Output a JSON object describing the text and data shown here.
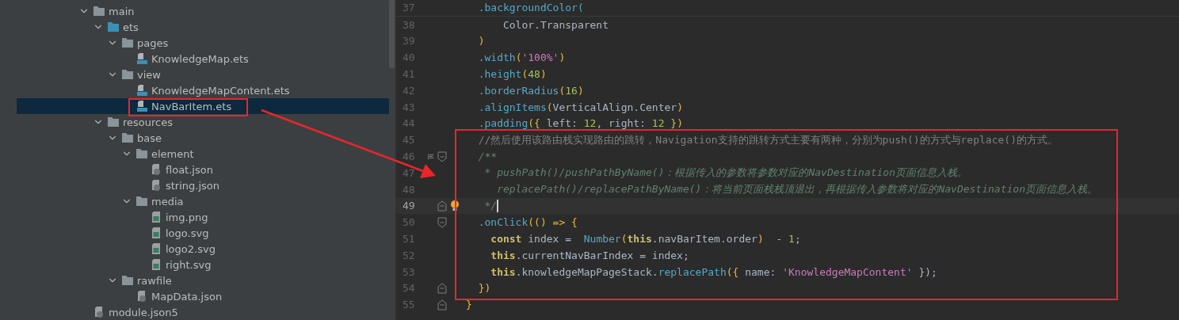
{
  "project_tree": {
    "items": [
      {
        "label": "main",
        "kind": "folder",
        "expanded": true,
        "selected": false,
        "children": [
          {
            "label": "ets",
            "kind": "source-folder",
            "expanded": true,
            "selected": false,
            "children": [
              {
                "label": "pages",
                "kind": "folder",
                "expanded": true,
                "selected": false,
                "children": [
                  {
                    "label": "KnowledgeMap.ets",
                    "kind": "ets",
                    "selected": false
                  }
                ]
              },
              {
                "label": "view",
                "kind": "folder",
                "expanded": true,
                "selected": false,
                "children": [
                  {
                    "label": "KnowledgeMapContent.ets",
                    "kind": "ets",
                    "selected": false
                  },
                  {
                    "label": "NavBarItem.ets",
                    "kind": "ets",
                    "selected": true
                  }
                ]
              }
            ]
          },
          {
            "label": "resources",
            "kind": "folder",
            "expanded": true,
            "selected": false,
            "children": [
              {
                "label": "base",
                "kind": "folder",
                "expanded": true,
                "selected": false,
                "children": [
                  {
                    "label": "element",
                    "kind": "folder",
                    "expanded": true,
                    "selected": false,
                    "children": [
                      {
                        "label": "float.json",
                        "kind": "json",
                        "selected": false
                      },
                      {
                        "label": "string.json",
                        "kind": "json",
                        "selected": false
                      }
                    ]
                  },
                  {
                    "label": "media",
                    "kind": "folder",
                    "expanded": true,
                    "selected": false,
                    "children": [
                      {
                        "label": "img.png",
                        "kind": "image",
                        "selected": false
                      },
                      {
                        "label": "logo.svg",
                        "kind": "image",
                        "selected": false
                      },
                      {
                        "label": "logo2.svg",
                        "kind": "image",
                        "selected": false
                      },
                      {
                        "label": "right.svg",
                        "kind": "image",
                        "selected": false
                      }
                    ]
                  }
                ]
              },
              {
                "label": "rawfile",
                "kind": "folder",
                "expanded": true,
                "selected": false,
                "children": [
                  {
                    "label": "MapData.json",
                    "kind": "json",
                    "selected": false
                  }
                ]
              }
            ]
          }
        ]
      },
      {
        "label": "module.json5",
        "kind": "json",
        "selected": false,
        "outdent": true
      }
    ]
  },
  "editor": {
    "lines": [
      {
        "number": "37",
        "current": false,
        "tokens": [
          {
            "text": "  .backgroundColor(",
            "kind": "method"
          }
        ]
      },
      {
        "number": "38",
        "current": false,
        "tokens": [
          {
            "text": "      Color.Transparent",
            "kind": "plain"
          }
        ]
      },
      {
        "number": "39",
        "current": false,
        "tokens": [
          {
            "text": "  )",
            "kind": "paren"
          }
        ]
      },
      {
        "number": "40",
        "current": false,
        "tokens": [
          {
            "text": "  .width",
            "kind": "method"
          },
          {
            "text": "(",
            "kind": "paren"
          },
          {
            "text": "'100%'",
            "kind": "string"
          },
          {
            "text": ")",
            "kind": "paren"
          }
        ]
      },
      {
        "number": "41",
        "current": false,
        "tokens": [
          {
            "text": "  .height",
            "kind": "method"
          },
          {
            "text": "(",
            "kind": "paren"
          },
          {
            "text": "48",
            "kind": "number"
          },
          {
            "text": ")",
            "kind": "paren"
          }
        ]
      },
      {
        "number": "42",
        "current": false,
        "tokens": [
          {
            "text": "  .borderRadius",
            "kind": "method"
          },
          {
            "text": "(",
            "kind": "paren"
          },
          {
            "text": "16",
            "kind": "number"
          },
          {
            "text": ")",
            "kind": "paren"
          }
        ]
      },
      {
        "number": "43",
        "current": false,
        "tokens": [
          {
            "text": "  .alignItems",
            "kind": "method"
          },
          {
            "text": "(",
            "kind": "paren"
          },
          {
            "text": "VerticalAlign.Center",
            "kind": "plain"
          },
          {
            "text": ")",
            "kind": "paren"
          }
        ]
      },
      {
        "number": "44",
        "current": false,
        "tokens": [
          {
            "text": "  .padding",
            "kind": "method"
          },
          {
            "text": "({",
            "kind": "paren"
          },
          {
            "text": " left: ",
            "kind": "plain"
          },
          {
            "text": "12",
            "kind": "number"
          },
          {
            "text": ", right: ",
            "kind": "plain"
          },
          {
            "text": "12",
            "kind": "number"
          },
          {
            "text": " })",
            "kind": "paren"
          }
        ]
      },
      {
        "number": "45",
        "current": false,
        "tokens": [
          {
            "text": "  //然后使用该路由栈实现路由的跳转，Navigation支持的跳转方式主要有两种，分别为push()的方式与replace()的方式。",
            "kind": "comment"
          }
        ]
      },
      {
        "number": "46",
        "current": false,
        "fold_start": true,
        "gutter_icon": true,
        "tokens": [
          {
            "text": "  /**",
            "kind": "doc"
          }
        ]
      },
      {
        "number": "47",
        "current": false,
        "tokens": [
          {
            "text": "   * pushPath()/pushPathByName()：根据传入的参数将参数对应的NavDestination页面信息入栈。",
            "kind": "doc"
          }
        ]
      },
      {
        "number": "48",
        "current": false,
        "tokens": [
          {
            "text": "     replacePath()/replacePathByName()：将当前页面栈栈顶退出，再根据传入参数将对应的NavDestination页面信息入栈。",
            "kind": "doc"
          }
        ]
      },
      {
        "number": "49",
        "current": true,
        "fold_end": true,
        "bulb": true,
        "tokens": [
          {
            "text": "   */",
            "kind": "doc"
          }
        ]
      },
      {
        "number": "50",
        "current": false,
        "fold_start": true,
        "tokens": [
          {
            "text": "  .onClick",
            "kind": "method"
          },
          {
            "text": "(() => {",
            "kind": "paren"
          }
        ]
      },
      {
        "number": "51",
        "current": false,
        "tokens": [
          {
            "text": "    const ",
            "kind": "keyword"
          },
          {
            "text": "index =  ",
            "kind": "plain"
          },
          {
            "text": "Number",
            "kind": "method"
          },
          {
            "text": "(",
            "kind": "paren"
          },
          {
            "text": "this",
            "kind": "keyword"
          },
          {
            "text": ".navBarItem.order",
            "kind": "plain"
          },
          {
            "text": ")",
            "kind": "paren"
          },
          {
            "text": "  - ",
            "kind": "plain"
          },
          {
            "text": "1",
            "kind": "number"
          },
          {
            "text": ";",
            "kind": "plain"
          }
        ]
      },
      {
        "number": "52",
        "current": false,
        "tokens": [
          {
            "text": "    this",
            "kind": "keyword"
          },
          {
            "text": ".currentNavBarIndex = index;",
            "kind": "plain"
          }
        ]
      },
      {
        "number": "53",
        "current": false,
        "tokens": [
          {
            "text": "    this",
            "kind": "keyword"
          },
          {
            "text": ".knowledgeMapPageStack.",
            "kind": "plain"
          },
          {
            "text": "replacePath",
            "kind": "method"
          },
          {
            "text": "({",
            "kind": "paren"
          },
          {
            "text": " name: ",
            "kind": "plain"
          },
          {
            "text": "'KnowledgeMapContent'",
            "kind": "string"
          },
          {
            "text": " });",
            "kind": "plain"
          }
        ]
      },
      {
        "number": "54",
        "current": false,
        "fold_end": true,
        "tokens": [
          {
            "text": "  })",
            "kind": "paren"
          }
        ]
      },
      {
        "number": "55",
        "current": false,
        "fold_end": true,
        "tokens": [
          {
            "text": "}",
            "kind": "paren"
          }
        ]
      }
    ]
  }
}
